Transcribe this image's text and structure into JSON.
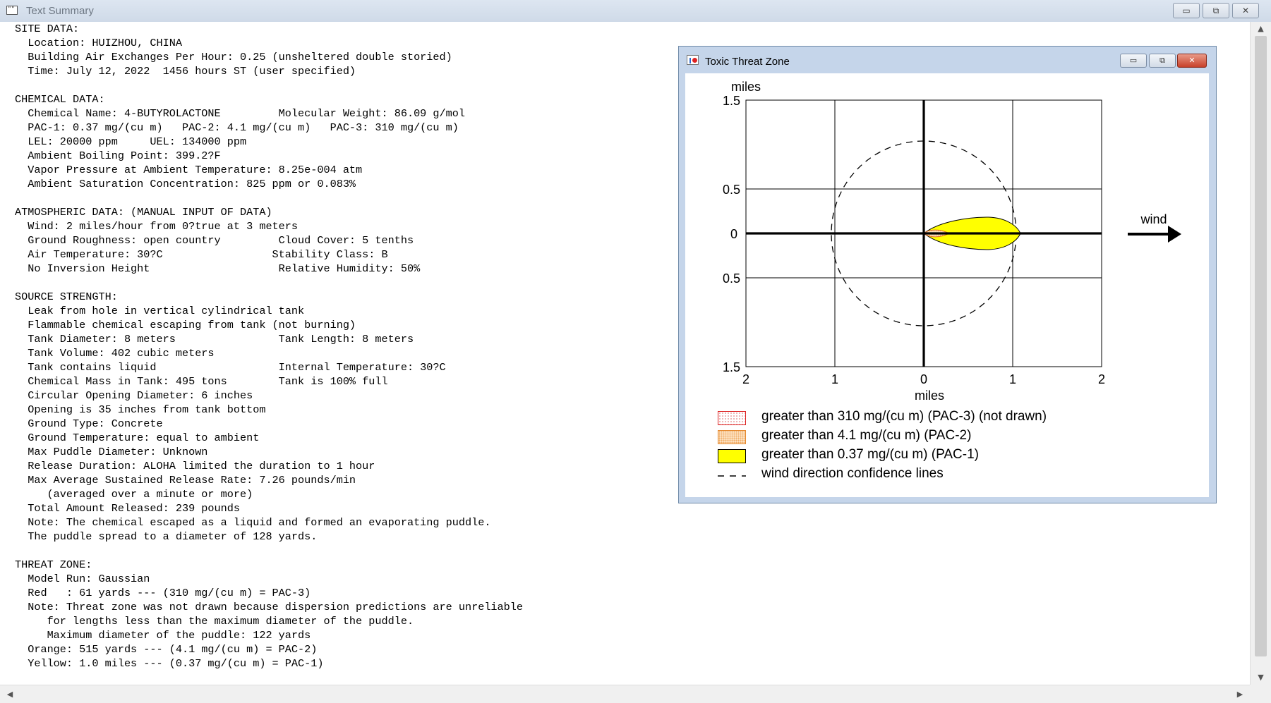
{
  "window": {
    "title": "Text Summary",
    "app_icon_text": "\"\"",
    "buttons": {
      "minimize": "▭",
      "maximize": "⧉",
      "close": "✕"
    }
  },
  "summary_lines": [
    "SITE DATA:",
    "  Location: HUIZHOU, CHINA",
    "  Building Air Exchanges Per Hour: 0.25 (unsheltered double storied)",
    "  Time: July 12, 2022  1456 hours ST (user specified)",
    "",
    "CHEMICAL DATA:",
    "  Chemical Name: 4-BUTYROLACTONE         Molecular Weight: 86.09 g/mol",
    "  PAC-1: 0.37 mg/(cu m)   PAC-2: 4.1 mg/(cu m)   PAC-3: 310 mg/(cu m)",
    "  LEL: 20000 ppm     UEL: 134000 ppm",
    "  Ambient Boiling Point: 399.2?F",
    "  Vapor Pressure at Ambient Temperature: 8.25e-004 atm",
    "  Ambient Saturation Concentration: 825 ppm or 0.083%",
    "",
    "ATMOSPHERIC DATA: (MANUAL INPUT OF DATA)",
    "  Wind: 2 miles/hour from 0?true at 3 meters",
    "  Ground Roughness: open country         Cloud Cover: 5 tenths",
    "  Air Temperature: 30?C                 Stability Class: B",
    "  No Inversion Height                    Relative Humidity: 50%",
    "",
    "SOURCE STRENGTH:",
    "  Leak from hole in vertical cylindrical tank",
    "  Flammable chemical escaping from tank (not burning)",
    "  Tank Diameter: 8 meters                Tank Length: 8 meters",
    "  Tank Volume: 402 cubic meters",
    "  Tank contains liquid                   Internal Temperature: 30?C",
    "  Chemical Mass in Tank: 495 tons        Tank is 100% full",
    "  Circular Opening Diameter: 6 inches",
    "  Opening is 35 inches from tank bottom",
    "  Ground Type: Concrete",
    "  Ground Temperature: equal to ambient",
    "  Max Puddle Diameter: Unknown",
    "  Release Duration: ALOHA limited the duration to 1 hour",
    "  Max Average Sustained Release Rate: 7.26 pounds/min",
    "     (averaged over a minute or more)",
    "  Total Amount Released: 239 pounds",
    "  Note: The chemical escaped as a liquid and formed an evaporating puddle.",
    "  The puddle spread to a diameter of 128 yards.",
    "",
    "THREAT ZONE:",
    "  Model Run: Gaussian",
    "  Red   : 61 yards --- (310 mg/(cu m) = PAC-3)",
    "  Note: Threat zone was not drawn because dispersion predictions are unreliable",
    "     for lengths less than the maximum diameter of the puddle.",
    "     Maximum diameter of the puddle: 122 yards",
    "  Orange: 515 yards --- (4.1 mg/(cu m) = PAC-2)",
    "  Yellow: 1.0 miles --- (0.37 mg/(cu m) = PAC-1)"
  ],
  "scrollbars": {
    "up": "▲",
    "down": "▼",
    "left": "◀",
    "right": "▶"
  },
  "threat_zone_window": {
    "title": "Toxic Threat Zone",
    "buttons": {
      "minimize": "▭",
      "maximize": "⧉",
      "close": "✕"
    },
    "plot": {
      "y_unit_label": "miles",
      "x_axis_label": "miles",
      "x_ticks": [
        "2",
        "1",
        "0",
        "1",
        "2"
      ],
      "y_ticks": [
        "1.5",
        "0.5",
        "0",
        "0.5",
        "1.5"
      ],
      "wind_label": "wind"
    },
    "legend": [
      {
        "key": "pac3",
        "label": "greater than 310 mg/(cu m) (PAC-3) (not drawn)"
      },
      {
        "key": "pac2",
        "label": "greater than 4.1 mg/(cu m) (PAC-2)"
      },
      {
        "key": "pac1",
        "label": "greater than 0.37 mg/(cu m) (PAC-1)"
      },
      {
        "key": "dash",
        "label": "wind direction confidence lines"
      }
    ],
    "colors": {
      "pac1": "#ffff00",
      "pac2": "#f6b878",
      "pac3": "#e02020"
    }
  }
}
